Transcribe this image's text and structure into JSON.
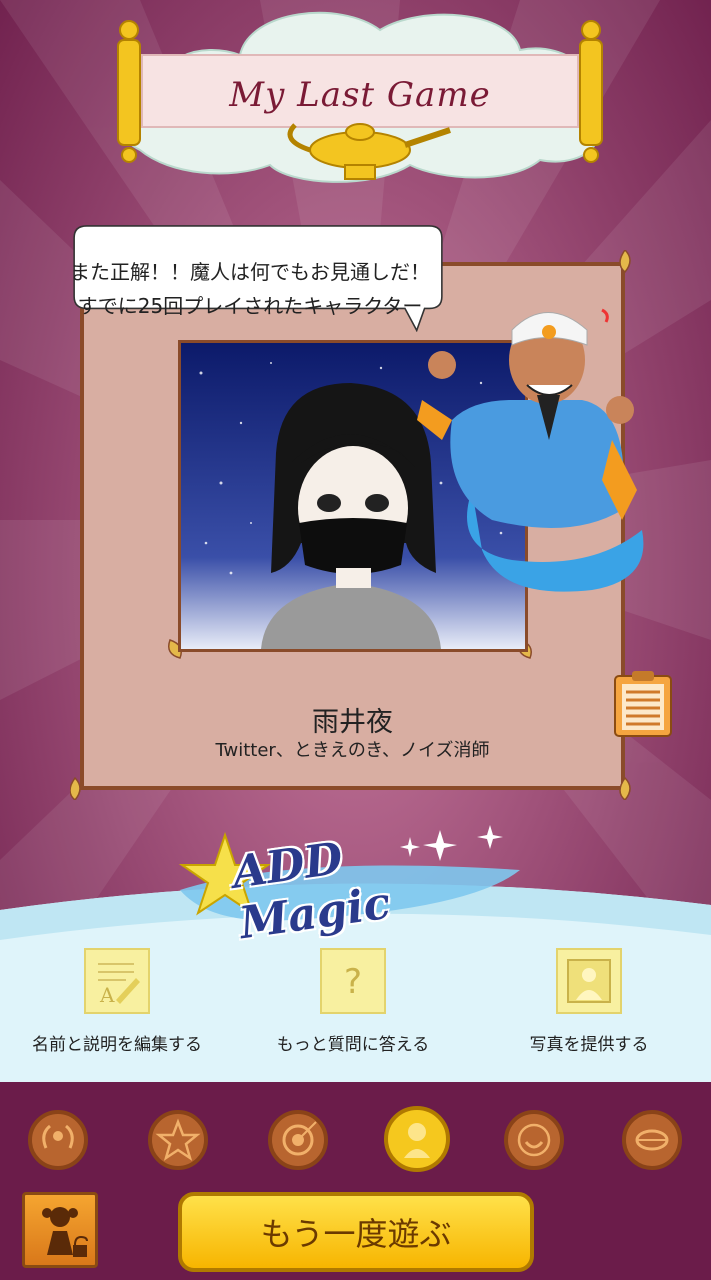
{
  "header": {
    "title": "My Last Game"
  },
  "speech": {
    "line1": "また正解！！魔人は何でもお見通しだ！",
    "line2": "すでに25回プレイされたキャラクター"
  },
  "character": {
    "name": "雨井夜",
    "description": "Twitter、ときえのき、ノイズ消師"
  },
  "add_magic": {
    "logo_text": "ADD Magic"
  },
  "actions": [
    {
      "label": "名前と説明を編集する",
      "icon": "edit-document-icon"
    },
    {
      "label": "もっと質問に答える",
      "icon": "question-icon"
    },
    {
      "label": "写真を提供する",
      "icon": "photo-person-icon"
    }
  ],
  "medals": [
    {
      "icon": "laurel-medal-icon",
      "state": "locked"
    },
    {
      "icon": "star-medal-icon",
      "state": "locked"
    },
    {
      "icon": "target-medal-icon",
      "state": "locked"
    },
    {
      "icon": "genie-medal-icon",
      "state": "active"
    },
    {
      "icon": "smile-medal-icon",
      "state": "locked"
    },
    {
      "icon": "lips-medal-icon",
      "state": "locked"
    }
  ],
  "bottom": {
    "play_again_label": "もう一度遊ぶ",
    "avatar_icon": "girl-lock-icon"
  },
  "colors": {
    "bg": "#7a2e5a",
    "card": "#d8aea2",
    "frame": "#8a4b2a",
    "button": "#f7b500"
  }
}
